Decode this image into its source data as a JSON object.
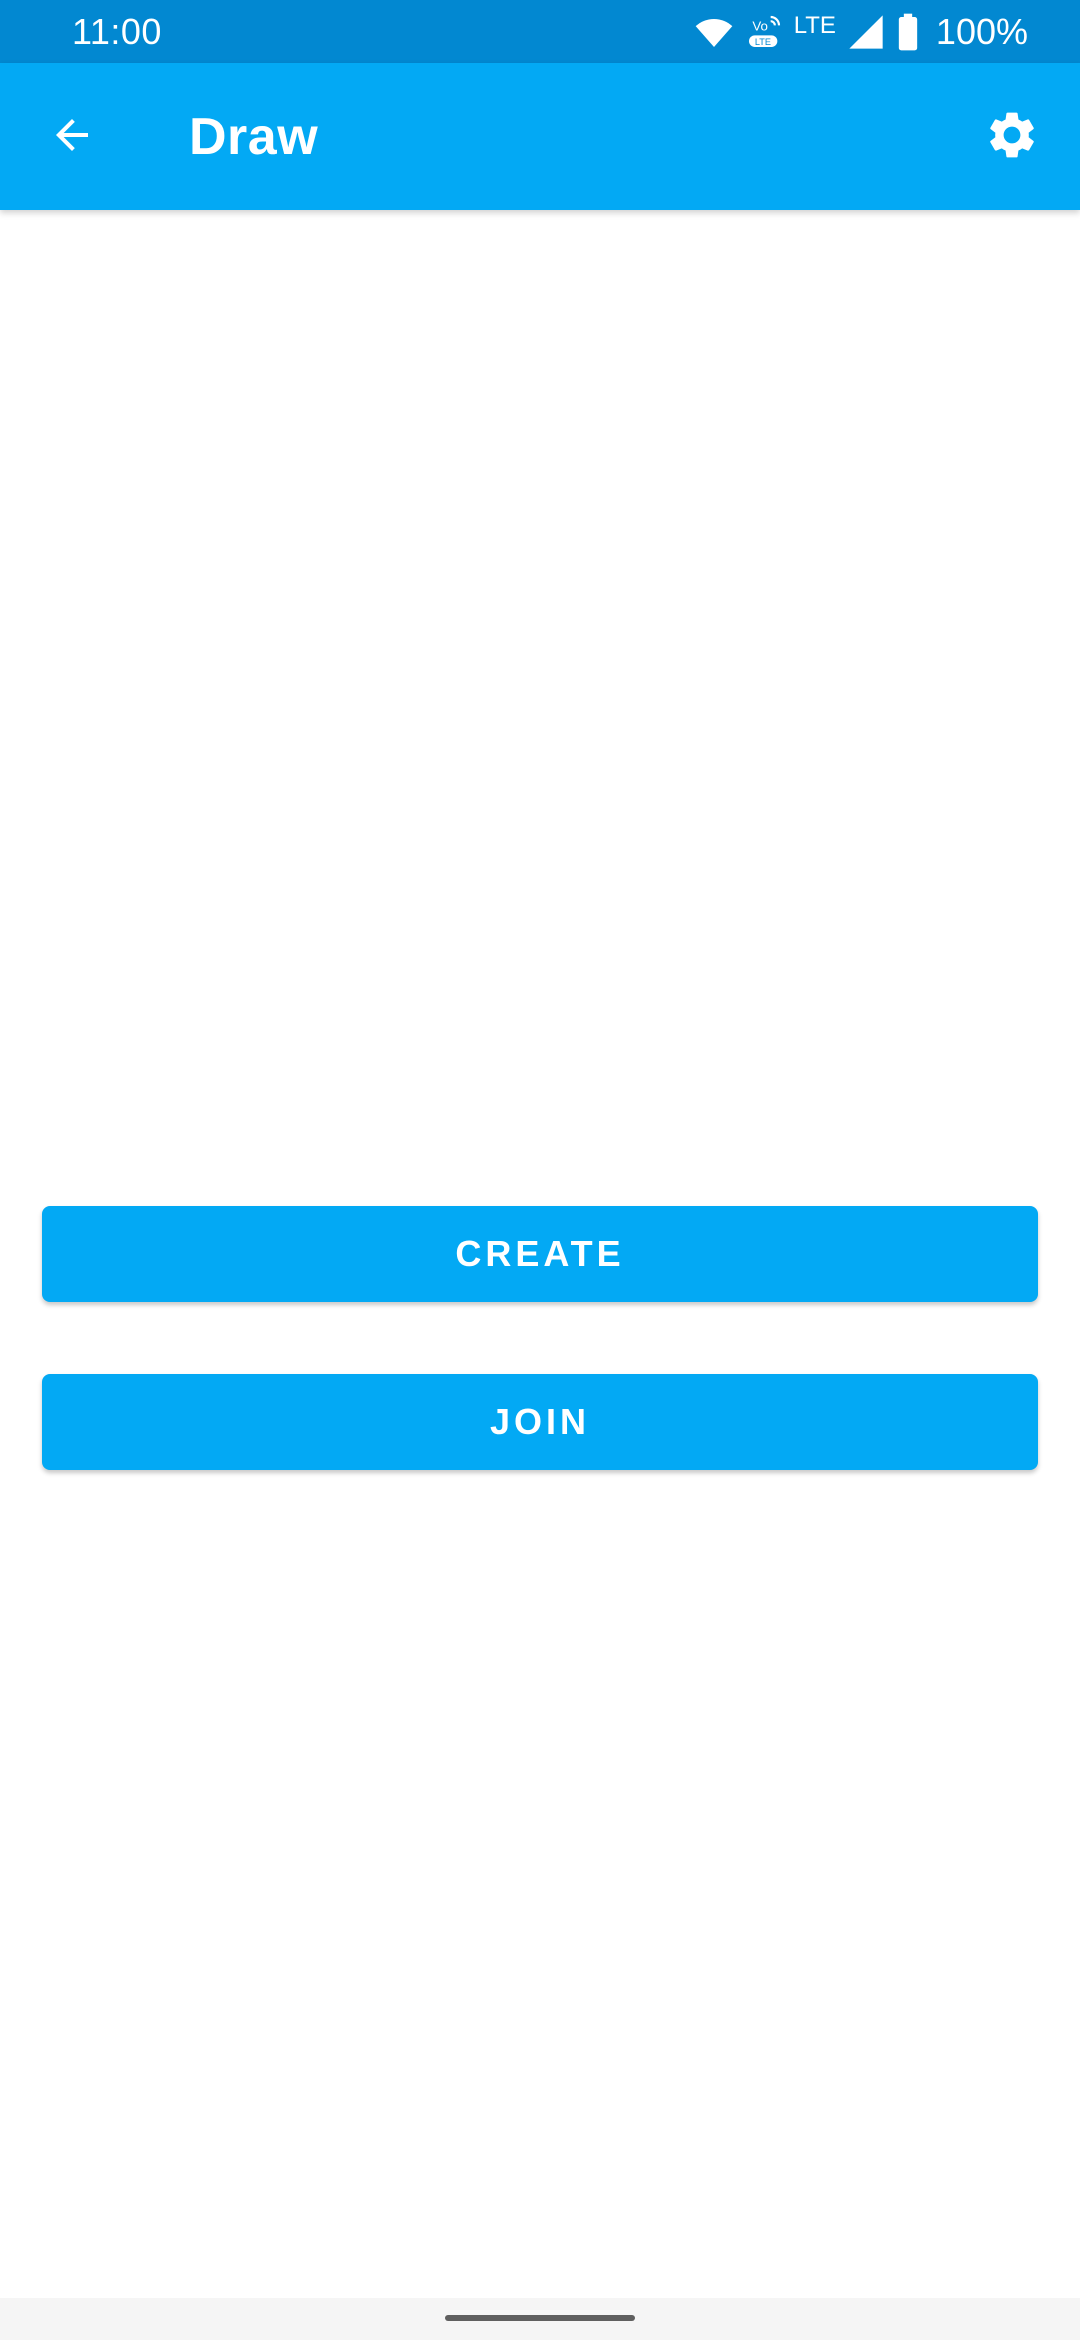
{
  "status_bar": {
    "time": "11:00",
    "network_label": "LTE",
    "volte_label": "VoLTE",
    "battery_percent": "100%",
    "icons": [
      "wifi-icon",
      "volte-icon",
      "lte-icon",
      "signal-icon",
      "battery-icon"
    ]
  },
  "app_bar": {
    "title": "Draw",
    "back_icon": "arrow-back-icon",
    "settings_icon": "gear-icon"
  },
  "actions": {
    "create_label": "CREATE",
    "join_label": "JOIN"
  },
  "colors": {
    "status_bar": "#0288D1",
    "primary": "#03A9F4",
    "background": "#FFFFFF",
    "nav_bar": "#F5F5F5"
  }
}
